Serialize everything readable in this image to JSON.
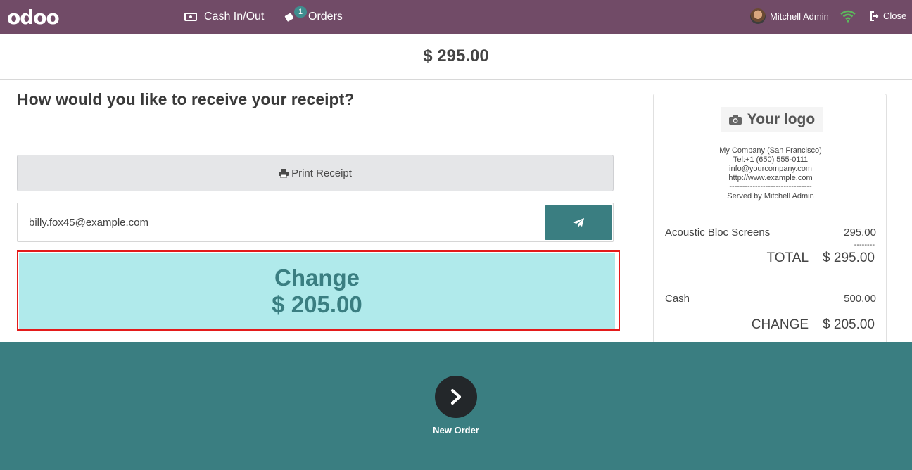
{
  "topbar": {
    "logo": "odoo",
    "cash_in_out": "Cash In/Out",
    "orders": "Orders",
    "orders_badge": "1",
    "user_name": "Mitchell Admin",
    "close": "Close",
    "brand_color": "#714B67"
  },
  "amount": "$ 295.00",
  "receipt_screen": {
    "question": "How would you like to receive your receipt?",
    "print_label": "Print Receipt",
    "email_value": "billy.fox45@example.com",
    "change_label": "Change",
    "change_value": "$ 205.00",
    "accent_color": "#3A7E81"
  },
  "receipt": {
    "logo_text": "Your logo",
    "company": "My Company (San Francisco)",
    "tel": "Tel:+1 (650) 555-0111",
    "email": "info@yourcompany.com",
    "website": "http://www.example.com",
    "separator": "--------------------------------",
    "served_by": "Served by Mitchell Admin",
    "item_name": "Acoustic Bloc Screens",
    "item_price": "295.00",
    "dashes": "--------",
    "total_label": "TOTAL",
    "total_value": "$ 295.00",
    "cash_label": "Cash",
    "cash_value": "500.00",
    "change_label": "CHANGE",
    "change_value": "$ 205.00"
  },
  "footer": {
    "new_order_label": "New Order"
  }
}
